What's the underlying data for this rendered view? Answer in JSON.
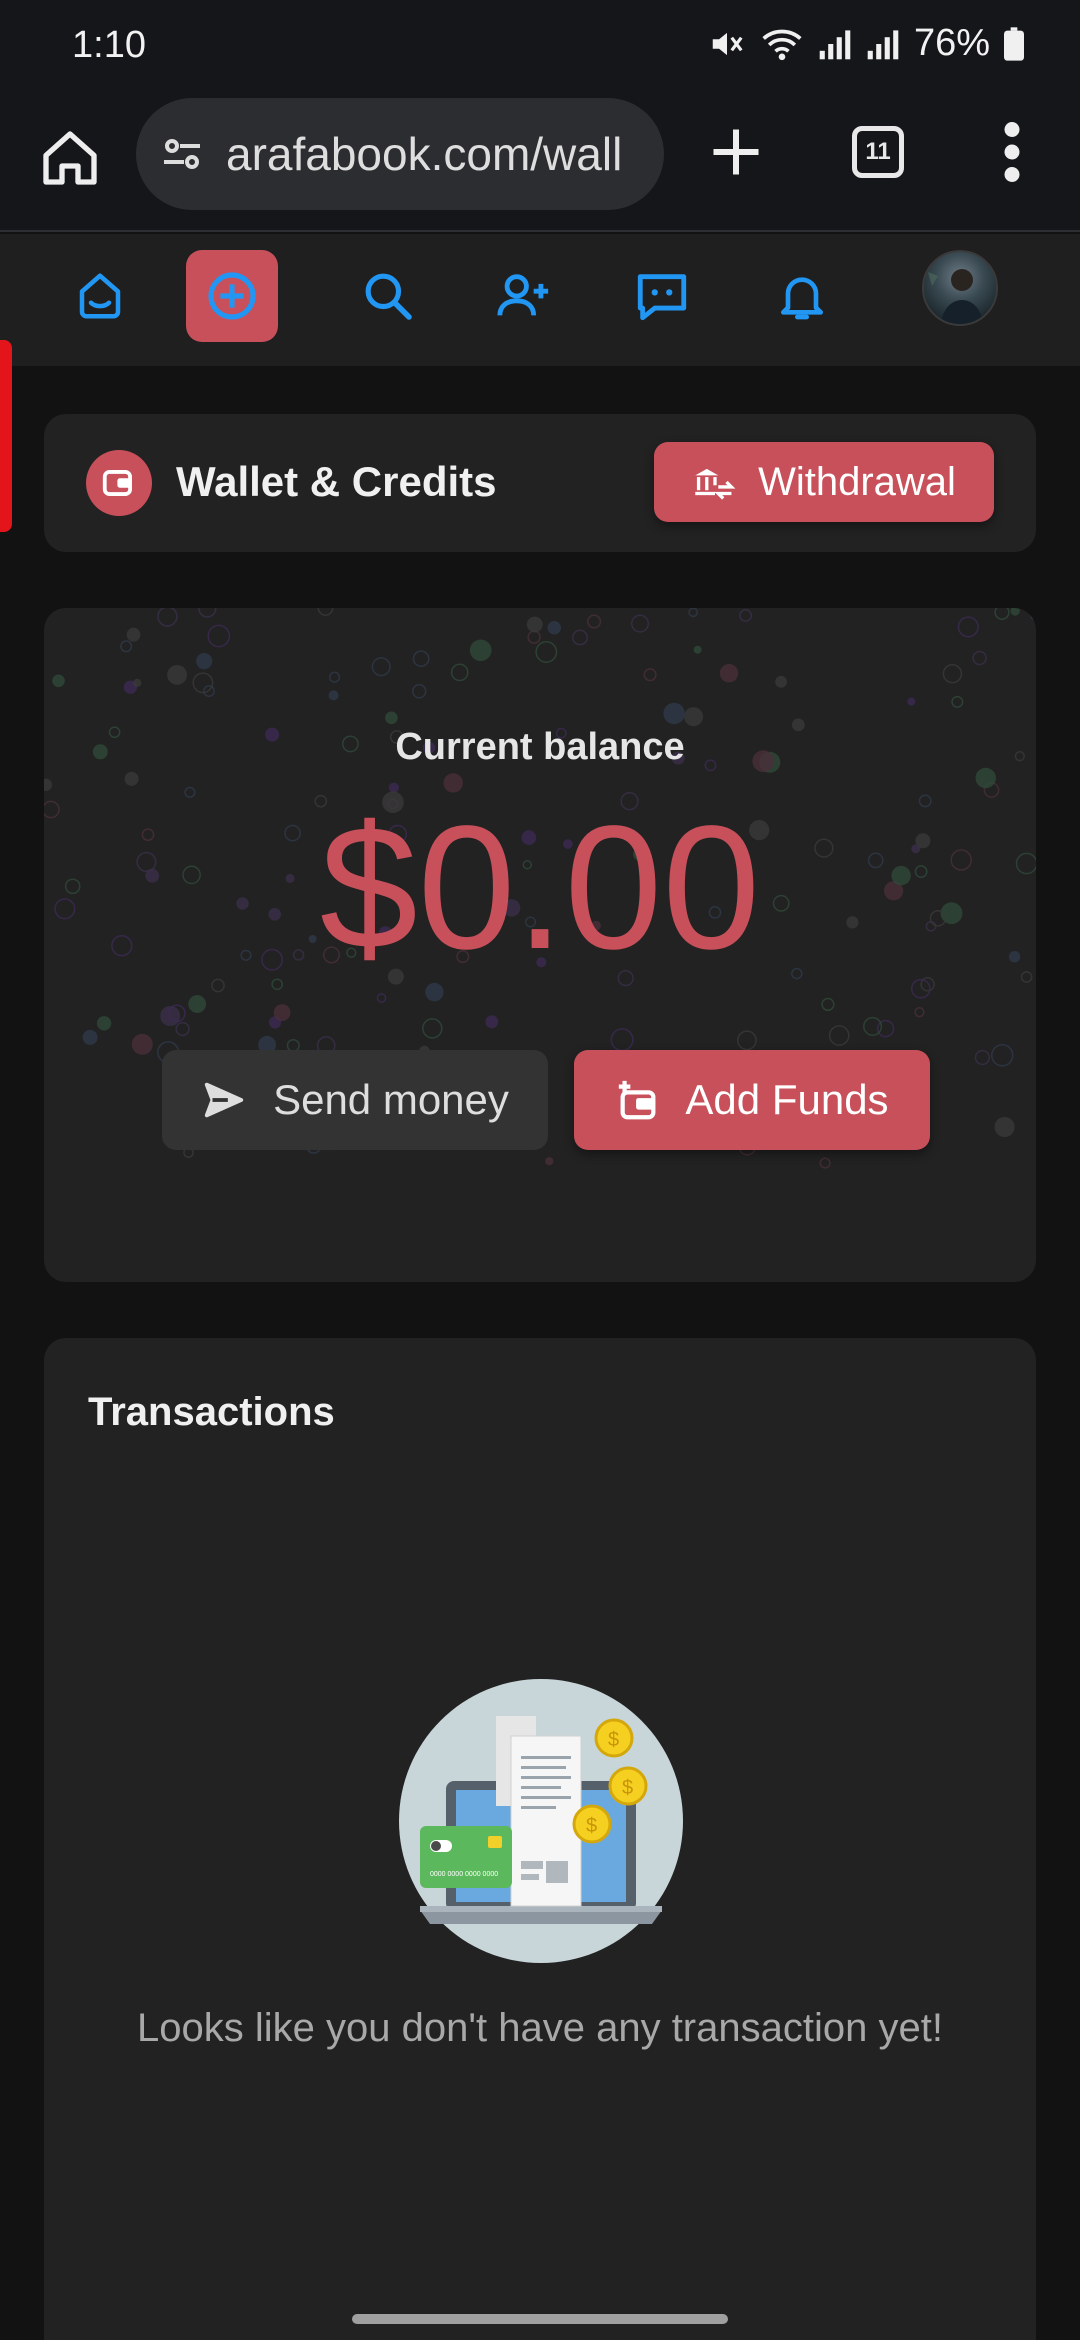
{
  "status_bar": {
    "time": "1:10",
    "battery": "76%",
    "icons": [
      "mute-icon",
      "wifi-icon",
      "signal-icon",
      "signal-icon",
      "battery-icon"
    ]
  },
  "browser": {
    "url": "arafabook.com/wall",
    "tab_count": "11",
    "icons": [
      "home-icon",
      "site-settings-icon",
      "plus-icon",
      "tabs-icon",
      "more-vert-icon"
    ]
  },
  "app_nav": {
    "items": [
      "home-icon",
      "add-circle-icon",
      "search-icon",
      "add-friend-icon",
      "messages-icon",
      "notifications-icon",
      "avatar"
    ],
    "active_index": 1
  },
  "wallet": {
    "title": "Wallet & Credits",
    "withdraw_label": "Withdrawal",
    "balance_label": "Current balance",
    "balance_amount": "$0.00",
    "send_label": "Send money",
    "add_funds_label": "Add Funds"
  },
  "transactions": {
    "title": "Transactions",
    "empty_message": "Looks like you don't have any transaction yet!",
    "illustration_card_number": "0000 0000 0000 0000"
  },
  "colors": {
    "accent": "#c8505a",
    "icon_blue": "#2196f3",
    "background": "#121212",
    "card": "#222222"
  }
}
